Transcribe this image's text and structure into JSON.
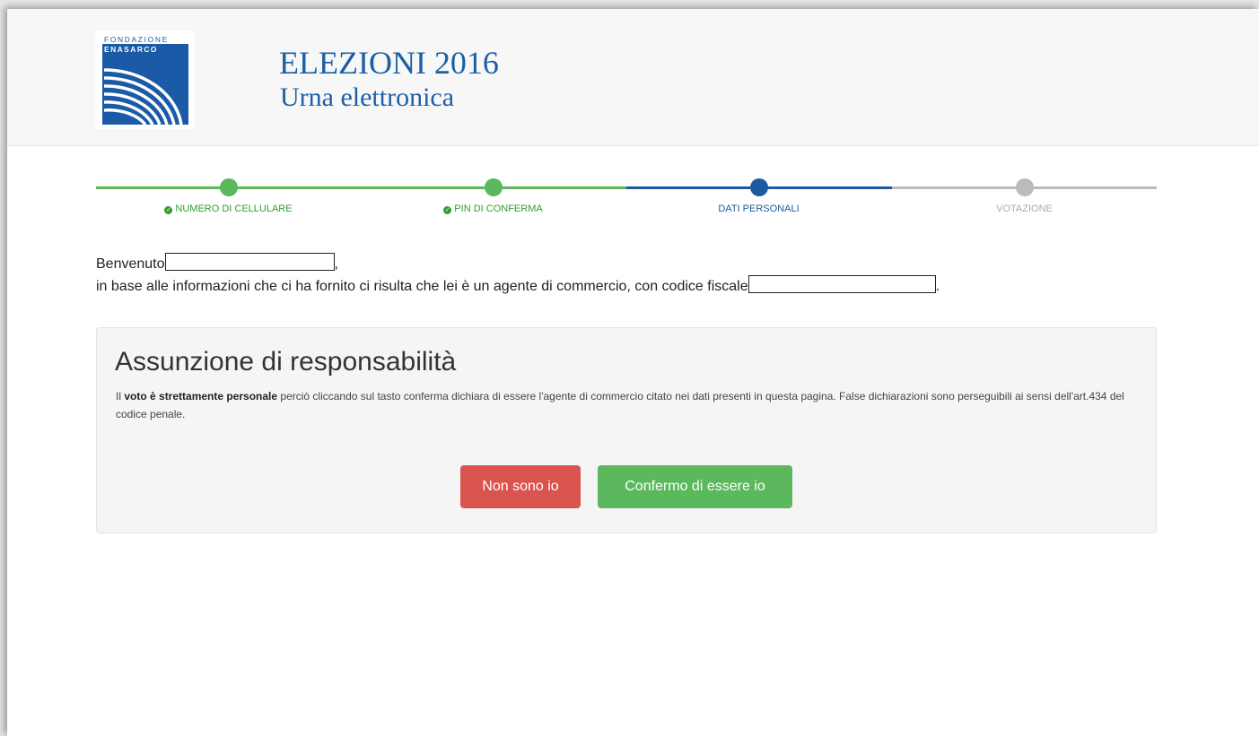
{
  "header": {
    "logo_top": "FONDAZIONE",
    "logo_bottom": "ENASARCO",
    "title": "ELEZIONI 2016",
    "subtitle": "Urna elettronica"
  },
  "wizard": {
    "steps": [
      {
        "label": "NUMERO DI CELLULARE",
        "status": "done"
      },
      {
        "label": "PIN DI CONFERMA",
        "status": "done"
      },
      {
        "label": "DATI PERSONALI",
        "status": "current"
      },
      {
        "label": "VOTAZIONE",
        "status": "pending"
      }
    ]
  },
  "intro": {
    "welcome": "Benvenuto",
    "welcome_suffix": ",",
    "line2": "in base alle informazioni che ci ha fornito ci risulta che lei è un agente di commercio, con codice fiscale",
    "line2_suffix": "."
  },
  "panel": {
    "title": "Assunzione di responsabilità",
    "text_pre": "Il ",
    "text_bold": "voto è strettamente personale",
    "text_post": " perciò cliccando sul tasto conferma dichiara di essere l'agente di commercio citato nei dati presenti in questa pagina. False dichiarazioni sono perseguibili ai sensi dell'art.434 del codice penale.",
    "btn_no": "Non sono io",
    "btn_yes": "Confermo di essere io"
  },
  "colors": {
    "brand_blue": "#1d5fa6",
    "step_done": "#5cb85c",
    "step_current": "#1e5aa0",
    "step_pending": "#bbbbbb",
    "danger": "#d9534f",
    "success": "#5cb85c"
  }
}
